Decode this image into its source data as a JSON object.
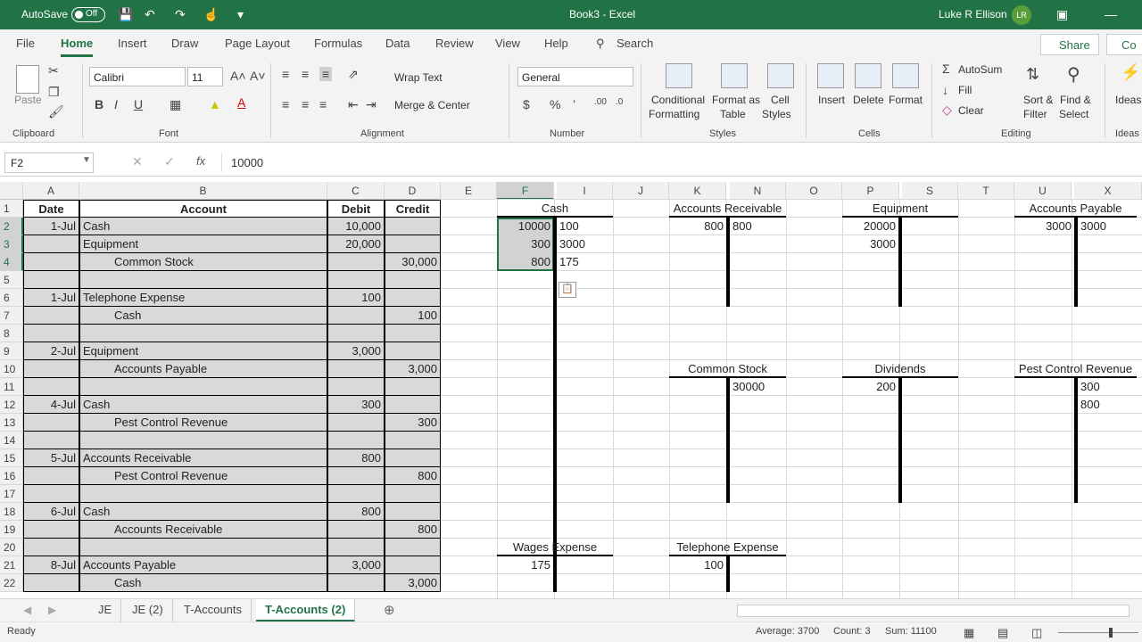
{
  "titlebar": {
    "autosave": "AutoSave",
    "toggle": "Off",
    "title": "Book3  -  Excel",
    "user": "Luke R Ellison",
    "initials": "LR"
  },
  "tabs": [
    "File",
    "Home",
    "Insert",
    "Draw",
    "Page Layout",
    "Formulas",
    "Data",
    "Review",
    "View",
    "Help"
  ],
  "search": "Search",
  "share": "Share",
  "co": "Co",
  "ribbon": {
    "paste": "Paste",
    "clipboard": "Clipboard",
    "font_name": "Calibri",
    "font_size": "11",
    "font": "Font",
    "wrap": "Wrap Text",
    "merge": "Merge & Center",
    "alignment": "Alignment",
    "number_format": "General",
    "number": "Number",
    "cond1": "Conditional",
    "cond2": "Formatting",
    "fmt1": "Format as",
    "fmt2": "Table",
    "cell1": "Cell",
    "cell2": "Styles",
    "styles": "Styles",
    "insert": "Insert",
    "delete": "Delete",
    "format": "Format",
    "cells": "Cells",
    "autosum": "AutoSum",
    "fill": "Fill",
    "clear": "Clear",
    "sort1": "Sort &",
    "sort2": "Filter",
    "find1": "Find &",
    "find2": "Select",
    "editing": "Editing",
    "ideas": "Ideas"
  },
  "formula": {
    "namebox": "F2",
    "value": "10000"
  },
  "columns": [
    "A",
    "B",
    "C",
    "D",
    "E",
    "F",
    "I",
    "J",
    "K",
    "N",
    "O",
    "P",
    "S",
    "T",
    "U",
    "X"
  ],
  "rows": [
    "1",
    "2",
    "3",
    "4",
    "5",
    "6",
    "7",
    "8",
    "9",
    "10",
    "11",
    "12",
    "13",
    "14",
    "15",
    "16",
    "17",
    "18",
    "19",
    "20",
    "21",
    "22"
  ],
  "journal": {
    "headers": [
      "Date",
      "Account",
      "Debit",
      "Credit"
    ],
    "rows": [
      [
        "1-Jul",
        "Cash",
        "10,000",
        ""
      ],
      [
        "",
        "Equipment",
        "20,000",
        ""
      ],
      [
        "",
        "Common Stock",
        "",
        "30,000"
      ],
      [
        "",
        "",
        "",
        ""
      ],
      [
        "1-Jul",
        "Telephone Expense",
        "100",
        ""
      ],
      [
        "",
        "Cash",
        "",
        "100"
      ],
      [
        "",
        "",
        "",
        ""
      ],
      [
        "2-Jul",
        "Equipment",
        "3,000",
        ""
      ],
      [
        "",
        "Accounts Payable",
        "",
        "3,000"
      ],
      [
        "",
        "",
        "",
        ""
      ],
      [
        "4-Jul",
        "Cash",
        "300",
        ""
      ],
      [
        "",
        "Pest Control Revenue",
        "",
        "300"
      ],
      [
        "",
        "",
        "",
        ""
      ],
      [
        "5-Jul",
        "Accounts Receivable",
        "800",
        ""
      ],
      [
        "",
        "Pest Control Revenue",
        "",
        "800"
      ],
      [
        "",
        "",
        "",
        ""
      ],
      [
        "6-Jul",
        "Cash",
        "800",
        ""
      ],
      [
        "",
        "Accounts Receivable",
        "",
        "800"
      ],
      [
        "",
        "",
        "",
        ""
      ],
      [
        "8-Jul",
        "Accounts Payable",
        "3,000",
        ""
      ],
      [
        "",
        "Cash",
        "",
        "3,000"
      ]
    ],
    "indented": [
      2,
      5,
      8,
      11,
      14,
      17,
      20
    ]
  },
  "taccounts": {
    "cash": {
      "title": "Cash",
      "left": [
        "10000",
        "300",
        "800"
      ],
      "right": [
        "100",
        "3000",
        "175"
      ]
    },
    "ar": {
      "title": "Accounts Receivable",
      "left": [
        "800"
      ],
      "right": [
        "800"
      ]
    },
    "equip": {
      "title": "Equipment",
      "left": [
        "20000",
        "3000"
      ],
      "right": []
    },
    "ap": {
      "title": "Accounts Payable",
      "left": [
        "3000"
      ],
      "right": [
        "3000"
      ]
    },
    "cs": {
      "title": "Common Stock",
      "left": [],
      "right": [
        "30000"
      ]
    },
    "div": {
      "title": "Dividends",
      "left": [
        "200"
      ],
      "right": []
    },
    "pcr": {
      "title": "Pest Control Revenue",
      "left": [],
      "right": [
        "300",
        "800"
      ]
    },
    "wages": {
      "title": "Wages Expense",
      "left": [
        "175"
      ],
      "right": []
    },
    "tel": {
      "title": "Telephone Expense",
      "left": [
        "100"
      ],
      "right": []
    }
  },
  "sheets": [
    "JE",
    "JE (2)",
    "T-Accounts",
    "T-Accounts (2)"
  ],
  "status": {
    "ready": "Ready",
    "average": "Average: 3700",
    "count": "Count: 3",
    "sum": "Sum: 11100"
  },
  "colors": {
    "accent": "#217346",
    "selection": "#d2d2d2",
    "journal_fill": "#d9d9d9"
  }
}
